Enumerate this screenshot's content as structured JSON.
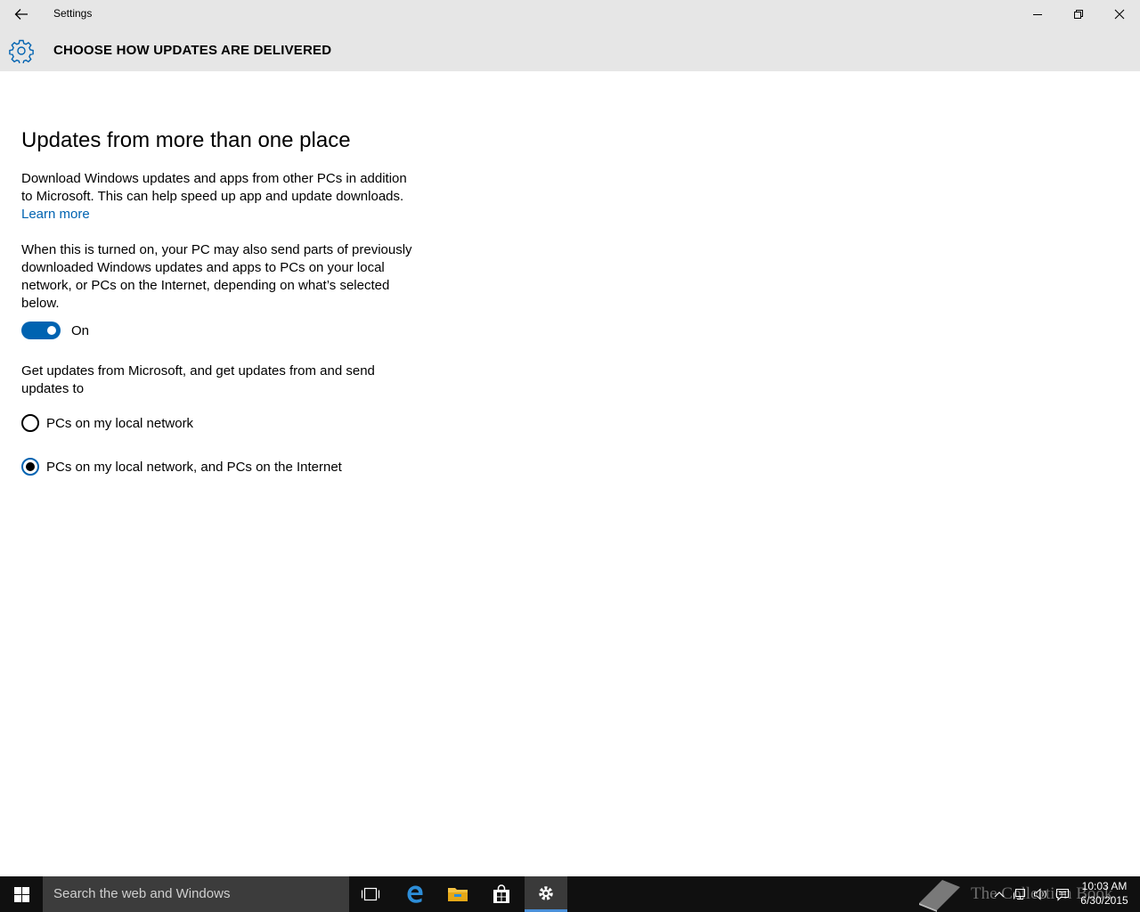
{
  "window": {
    "title": "Settings"
  },
  "header": {
    "title": "CHOOSE HOW UPDATES ARE DELIVERED",
    "icon": "gear-icon"
  },
  "content": {
    "section_title": "Updates from more than one place",
    "description": "Download Windows updates and apps from other PCs in addition to Microsoft. This can help speed up app and update downloads.",
    "learn_more": "Learn more",
    "toggle_description": "When this is turned on, your PC may also send parts of previously downloaded Windows updates and apps to PCs on your local network, or PCs on the Internet, depending on what’s selected below.",
    "toggle": {
      "state": true,
      "label": "On"
    },
    "radio_group_label": "Get updates from Microsoft, and get updates from and send updates to",
    "options": [
      {
        "label": "PCs on my local network",
        "selected": false
      },
      {
        "label": "PCs on my local network, and PCs on the Internet",
        "selected": true
      }
    ]
  },
  "taskbar": {
    "search_placeholder": "Search the web and Windows",
    "watermark": "The Collection Book",
    "clock": {
      "time": "10:03 AM",
      "date": "6/30/2015"
    }
  },
  "colors": {
    "accent": "#0063b1",
    "titlebar_bg": "#e6e6e6",
    "taskbar_bg": "#101010"
  }
}
